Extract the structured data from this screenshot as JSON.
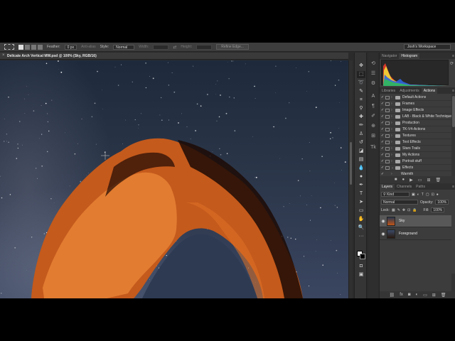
{
  "options_bar": {
    "feather_label": "Feather:",
    "feather_value": "0 px",
    "antialias_label": "Anti-alias",
    "style_label": "Style:",
    "style_value": "Normal",
    "width_label": "Width:",
    "height_label": "Height:",
    "refine_edge_label": "Refine Edge...",
    "workspace_value": "Josh's Workspace"
  },
  "document": {
    "tab_title": "Delicate Arch Vertical MW.psd @ 100% (Sky, RGB/16)"
  },
  "panels": {
    "top_tabs": [
      "Navigator",
      "Histogram"
    ],
    "top_active": "Histogram",
    "mid_tabs": [
      "Libraries",
      "Adjustments",
      "Actions"
    ],
    "mid_active": "Actions",
    "actions": [
      {
        "name": "Default Actions",
        "type": "set"
      },
      {
        "name": "Frames",
        "type": "set"
      },
      {
        "name": "Image Effects",
        "type": "set"
      },
      {
        "name": "LAB - Black & White Technique",
        "type": "set"
      },
      {
        "name": "Production",
        "type": "set"
      },
      {
        "name": "TK-V4-Actions",
        "type": "set"
      },
      {
        "name": "Textures",
        "type": "set"
      },
      {
        "name": "Text Effects",
        "type": "set"
      },
      {
        "name": "Stars Trails",
        "type": "set"
      },
      {
        "name": "My Actions",
        "type": "set"
      },
      {
        "name": "Portrait stuff",
        "type": "set"
      },
      {
        "name": "Effects",
        "type": "set_open"
      },
      {
        "name": "Warmth",
        "type": "action"
      }
    ],
    "layer_tabs": [
      "Layers",
      "Channels",
      "Paths"
    ],
    "layer_active": "Layers",
    "kind_label": "Kind",
    "blend_mode": "Normal",
    "opacity_label": "Opacity:",
    "opacity_value": "100%",
    "lock_label": "Lock:",
    "fill_label": "Fill:",
    "fill_value": "100%",
    "layers": [
      {
        "name": "Sky",
        "selected": true
      },
      {
        "name": "Foreground",
        "selected": false
      }
    ]
  },
  "colors": {
    "accent": "#585858",
    "rock": "#c0561a",
    "sky": "#1e2a3c"
  }
}
